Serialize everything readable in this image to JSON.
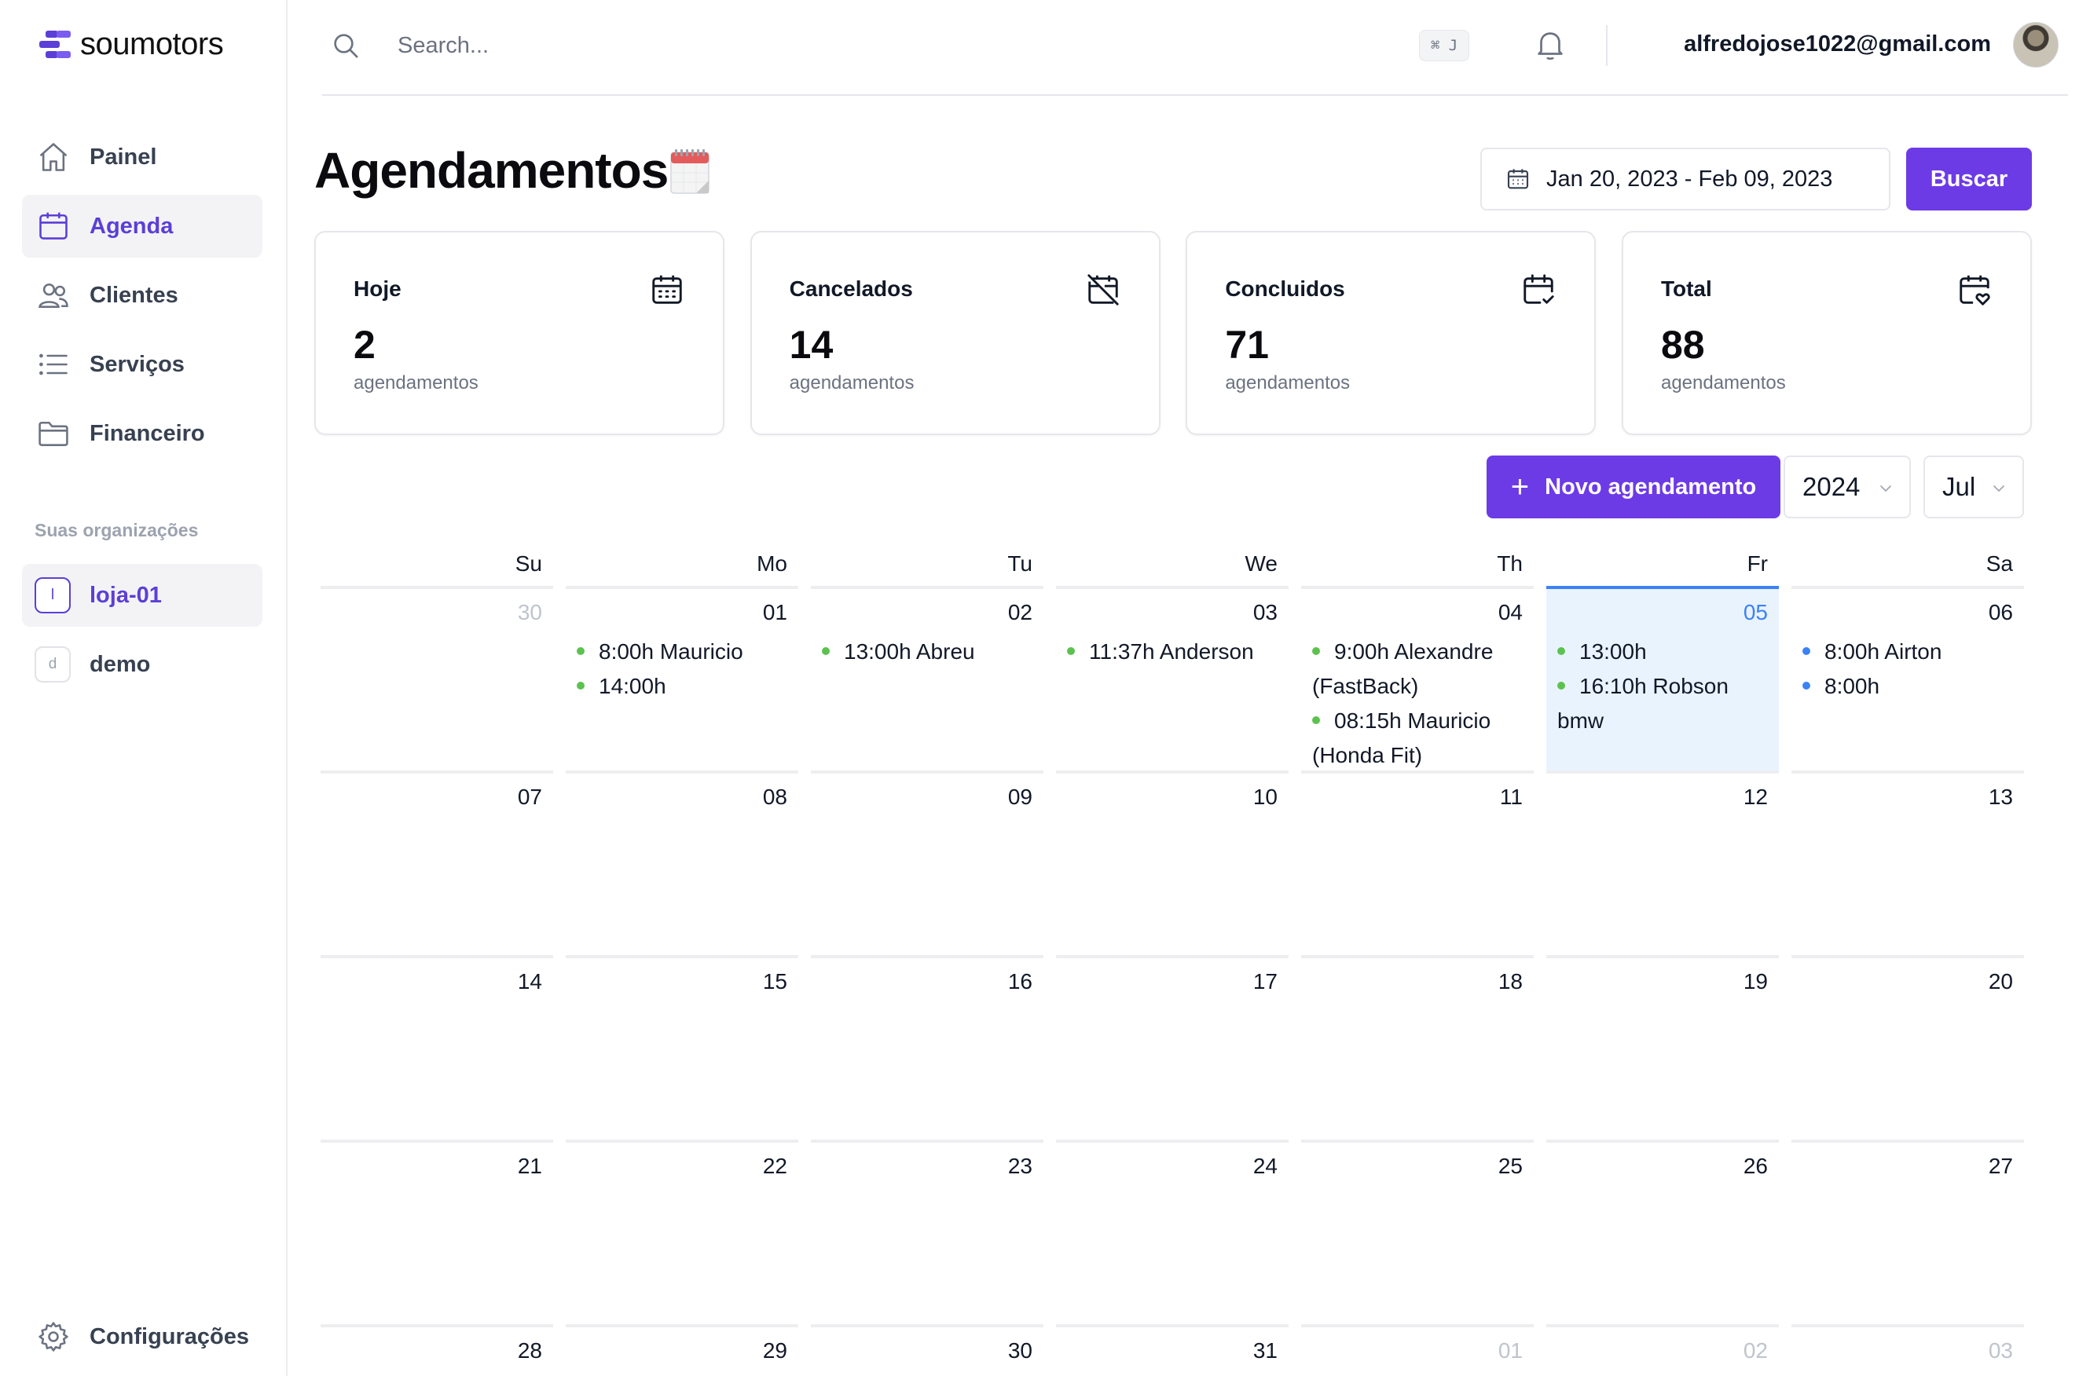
{
  "brand": {
    "name": "soumotors",
    "color": "#5b3fd6"
  },
  "sidebar": {
    "items": [
      {
        "label": "Painel",
        "icon": "home-icon",
        "active": false
      },
      {
        "label": "Agenda",
        "icon": "calendar-icon",
        "active": true
      },
      {
        "label": "Clientes",
        "icon": "users-icon",
        "active": false
      },
      {
        "label": "Serviços",
        "icon": "list-icon",
        "active": false
      },
      {
        "label": "Financeiro",
        "icon": "folder-icon",
        "active": false
      }
    ],
    "org_title": "Suas organizações",
    "orgs": [
      {
        "badge": "l",
        "label": "loja-01",
        "active": true
      },
      {
        "badge": "d",
        "label": "demo",
        "active": false
      }
    ],
    "settings_label": "Configurações"
  },
  "header": {
    "search_placeholder": "Search...",
    "shortcut": "⌘ J",
    "user_email": "alfredojose1022@gmail.com"
  },
  "page": {
    "title": "Agendamentos",
    "date_range": "Jan 20, 2023 - Feb 09, 2023",
    "search_button": "Buscar",
    "new_button": "Novo agendamento",
    "year": "2024",
    "month": "Jul"
  },
  "stats": [
    {
      "label": "Hoje",
      "value": "2",
      "sub": "agendamentos",
      "icon": "calendar-days-icon"
    },
    {
      "label": "Cancelados",
      "value": "14",
      "sub": "agendamentos",
      "icon": "calendar-off-icon"
    },
    {
      "label": "Concluidos",
      "value": "71",
      "sub": "agendamentos",
      "icon": "calendar-check-icon"
    },
    {
      "label": "Total",
      "value": "88",
      "sub": "agendamentos",
      "icon": "calendar-heart-icon"
    }
  ],
  "calendar": {
    "weekdays": [
      "Su",
      "Mo",
      "Tu",
      "We",
      "Th",
      "Fr",
      "Sa"
    ],
    "weeks": [
      [
        {
          "day": "30",
          "muted": true,
          "events": []
        },
        {
          "day": "01",
          "events": [
            {
              "text": "8:00h Mauricio",
              "color": "green"
            },
            {
              "text": "14:00h",
              "color": "green"
            }
          ]
        },
        {
          "day": "02",
          "events": [
            {
              "text": "13:00h Abreu",
              "color": "green"
            }
          ]
        },
        {
          "day": "03",
          "events": [
            {
              "text": "11:37h Anderson",
              "color": "green"
            }
          ]
        },
        {
          "day": "04",
          "events": [
            {
              "text": "9:00h Alexandre (FastBack)",
              "color": "green"
            },
            {
              "text": "08:15h Mauricio (Honda Fit)",
              "color": "green"
            }
          ]
        },
        {
          "day": "05",
          "today": true,
          "events": [
            {
              "text": "13:00h",
              "color": "green"
            },
            {
              "text": "16:10h Robson bmw",
              "color": "green"
            }
          ]
        },
        {
          "day": "06",
          "events": [
            {
              "text": "8:00h Airton",
              "color": "blue"
            },
            {
              "text": "8:00h",
              "color": "blue"
            }
          ]
        }
      ],
      [
        {
          "day": "07"
        },
        {
          "day": "08"
        },
        {
          "day": "09"
        },
        {
          "day": "10"
        },
        {
          "day": "11"
        },
        {
          "day": "12"
        },
        {
          "day": "13"
        }
      ],
      [
        {
          "day": "14"
        },
        {
          "day": "15"
        },
        {
          "day": "16"
        },
        {
          "day": "17"
        },
        {
          "day": "18"
        },
        {
          "day": "19"
        },
        {
          "day": "20"
        }
      ],
      [
        {
          "day": "21"
        },
        {
          "day": "22"
        },
        {
          "day": "23"
        },
        {
          "day": "24"
        },
        {
          "day": "25"
        },
        {
          "day": "26"
        },
        {
          "day": "27"
        }
      ],
      [
        {
          "day": "28"
        },
        {
          "day": "29"
        },
        {
          "day": "30"
        },
        {
          "day": "31"
        },
        {
          "day": "01",
          "muted": true
        },
        {
          "day": "02",
          "muted": true
        },
        {
          "day": "03",
          "muted": true
        }
      ]
    ]
  },
  "colors": {
    "accent": "#6d3be6",
    "today": "#3b82f6",
    "event_green": "#5cc24f",
    "event_blue": "#3b82f6"
  }
}
